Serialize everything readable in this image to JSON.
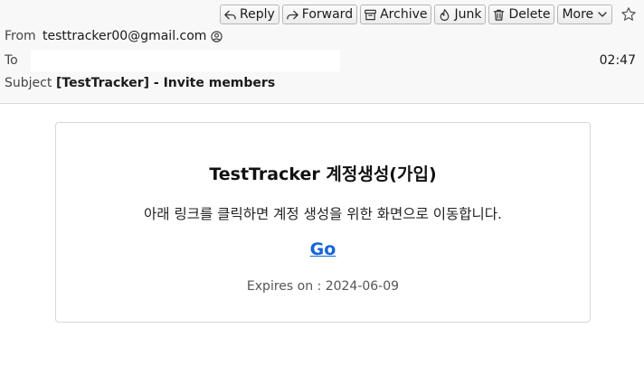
{
  "toolbar": {
    "reply_label": "Reply",
    "forward_label": "Forward",
    "archive_label": "Archive",
    "junk_label": "Junk",
    "delete_label": "Delete",
    "more_label": "More",
    "icons": [
      "reply-icon",
      "forward-icon",
      "archive-icon",
      "junk-icon",
      "delete-icon",
      "chevron-down-icon",
      "star-icon"
    ]
  },
  "header": {
    "from_label": "From",
    "from_value": "testtracker00@gmail.com",
    "to_label": "To",
    "to_value": "",
    "date": "02:47",
    "subject_label": "Subject",
    "subject_value": "[TestTracker] - Invite members"
  },
  "message": {
    "title": "TestTracker 계정생성(가입)",
    "description": "아래 링크를 클릭하면 계정 생성을 위한 화면으로 이동합니다.",
    "link_label": "Go",
    "expires": "Expires on : 2024-06-09",
    "link_color": "#1565d8"
  }
}
